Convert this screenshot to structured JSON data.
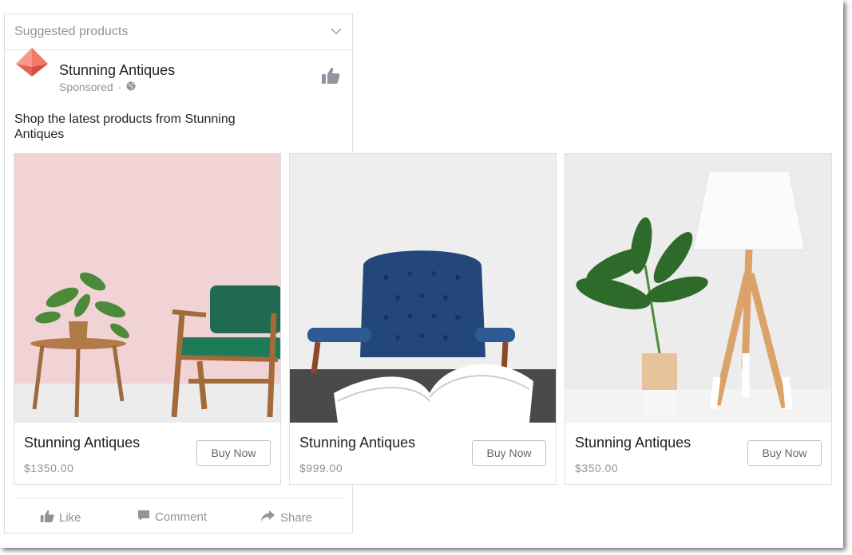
{
  "header": {
    "title": "Suggested products"
  },
  "post": {
    "page_name": "Stunning Antiques",
    "sponsored": "Sponsored",
    "separator": "·",
    "description": "Shop the latest  products from Stunning Antiques"
  },
  "products": [
    {
      "name": "Stunning Antiques",
      "price": "$1350.00",
      "button": "Buy Now"
    },
    {
      "name": "Stunning Antiques",
      "price": "$999.00",
      "button": "Buy Now"
    },
    {
      "name": "Stunning Antiques",
      "price": "$350.00",
      "button": "Buy Now"
    }
  ],
  "actions": {
    "like": "Like",
    "comment": "Comment",
    "share": "Share"
  },
  "colors": {
    "text": "#1d2129",
    "muted": "#90949c",
    "border": "#dddfe2",
    "logo": "#f08a7a"
  },
  "icons": [
    "chevron-down-icon",
    "pyramid-logo-icon",
    "globe-icon",
    "thumbs-up-icon",
    "comment-icon",
    "share-icon"
  ]
}
